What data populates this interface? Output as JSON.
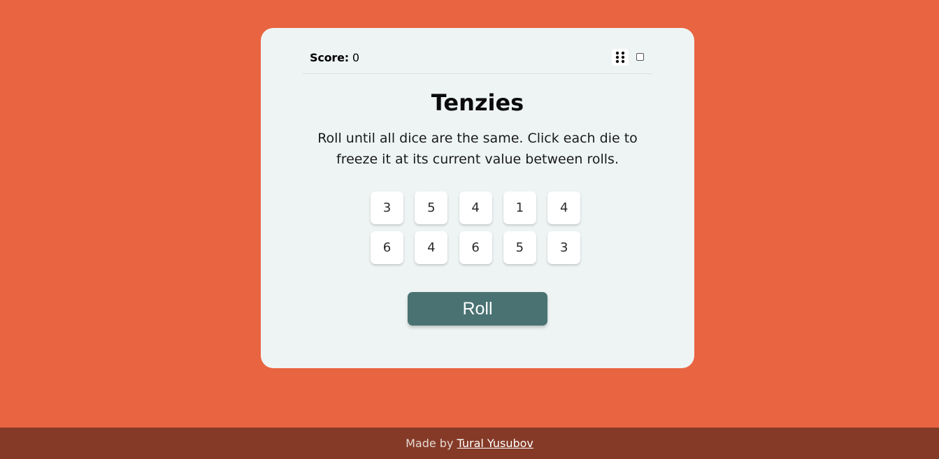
{
  "app": {
    "title": "Tenzies",
    "description": "Roll until all dice are the same. Click each die to freeze it at its current value between rolls."
  },
  "header": {
    "score_label": "Score:",
    "score_value": "0",
    "dots_icon": "dots-grid-icon",
    "toggle_checked": false
  },
  "dice": [
    {
      "value": "3",
      "frozen": false
    },
    {
      "value": "5",
      "frozen": false
    },
    {
      "value": "4",
      "frozen": false
    },
    {
      "value": "1",
      "frozen": false
    },
    {
      "value": "4",
      "frozen": false
    },
    {
      "value": "6",
      "frozen": false
    },
    {
      "value": "4",
      "frozen": false
    },
    {
      "value": "6",
      "frozen": false
    },
    {
      "value": "5",
      "frozen": false
    },
    {
      "value": "3",
      "frozen": false
    }
  ],
  "roll_button": {
    "label": "Roll"
  },
  "footer": {
    "made_by": "Made by",
    "author": "Tural Yusubov"
  },
  "colors": {
    "background": "#E96441",
    "card": "#EEF4F4",
    "button": "#4A7272",
    "footer": "#853A27"
  }
}
